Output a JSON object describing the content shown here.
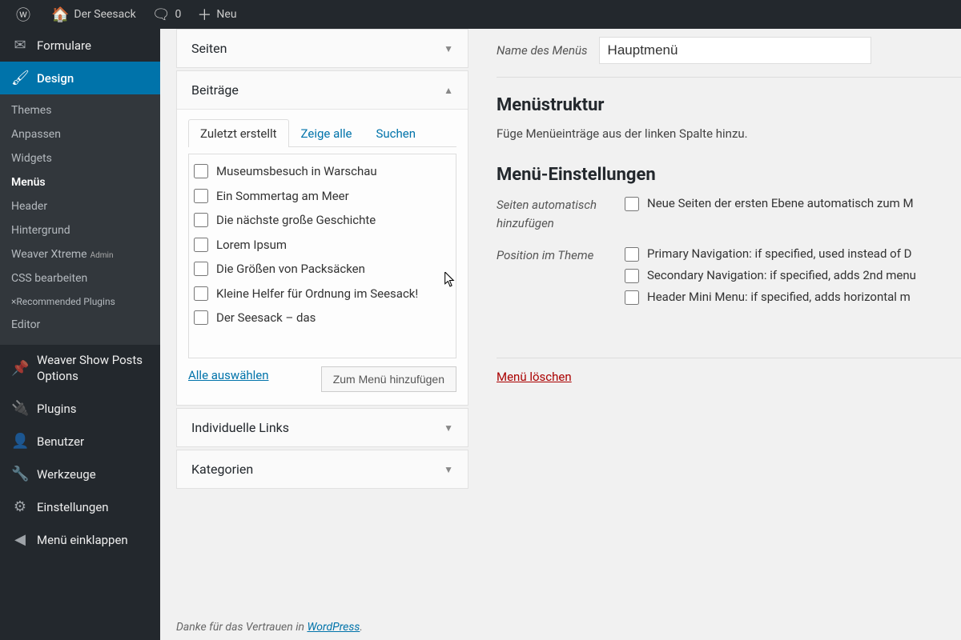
{
  "adminbar": {
    "site_title": "Der Seesack",
    "comments_count": "0",
    "new_label": "Neu"
  },
  "sidebar": {
    "formulare": "Formulare",
    "design": "Design",
    "design_sub": {
      "themes": "Themes",
      "anpassen": "Anpassen",
      "widgets": "Widgets",
      "menus": "Menüs",
      "header": "Header",
      "hintergrund": "Hintergrund",
      "weaver_xtreme": "Weaver Xtreme",
      "weaver_admin_sup": "Admin",
      "css_bearbeiten": "CSS bearbeiten",
      "recommended_plugins": "×Recommended Plugins",
      "editor": "Editor"
    },
    "weaver_show_posts": "Weaver Show Posts Options",
    "plugins": "Plugins",
    "benutzer": "Benutzer",
    "werkzeuge": "Werkzeuge",
    "einstellungen": "Einstellungen",
    "menu_einklappen": "Menü einklappen"
  },
  "accordions": {
    "seiten": "Seiten",
    "beitraege": "Beiträge",
    "individuelle_links": "Individuelle Links",
    "kategorien": "Kategorien"
  },
  "beitraege_panel": {
    "tabs": {
      "recent": "Zuletzt erstellt",
      "all": "Zeige alle",
      "search": "Suchen"
    },
    "posts": [
      "Museumsbesuch in Warschau",
      "Ein Sommertag am Meer",
      "Die nächste große Geschichte",
      "Lorem Ipsum",
      "Die Größen von Packsäcken",
      "Kleine Helfer für Ordnung im Seesack!",
      "Der Seesack – das"
    ],
    "select_all": "Alle auswählen",
    "add_button": "Zum Menü hinzufügen"
  },
  "menu_edit": {
    "name_label": "Name des Menüs",
    "name_value": "Hauptmenü",
    "structure_heading": "Menüstruktur",
    "structure_help": "Füge Menüeinträge aus der linken Spalte hinzu.",
    "settings_heading": "Menü-Einstellungen",
    "auto_add_label": "Seiten automatisch hinzufügen",
    "auto_add_opt": "Neue Seiten der ersten Ebene automatisch zum M",
    "position_label": "Position im Theme",
    "pos_opts": [
      "Primary Navigation: if specified, used instead of D",
      "Secondary Navigation: if specified, adds 2nd menu",
      "Header Mini Menu: if specified, adds horizontal m"
    ],
    "delete_link": "Menü löschen"
  },
  "footer": {
    "thanks_pre": "Danke für das Vertrauen in ",
    "wp": "WordPress",
    "suffix": "."
  }
}
